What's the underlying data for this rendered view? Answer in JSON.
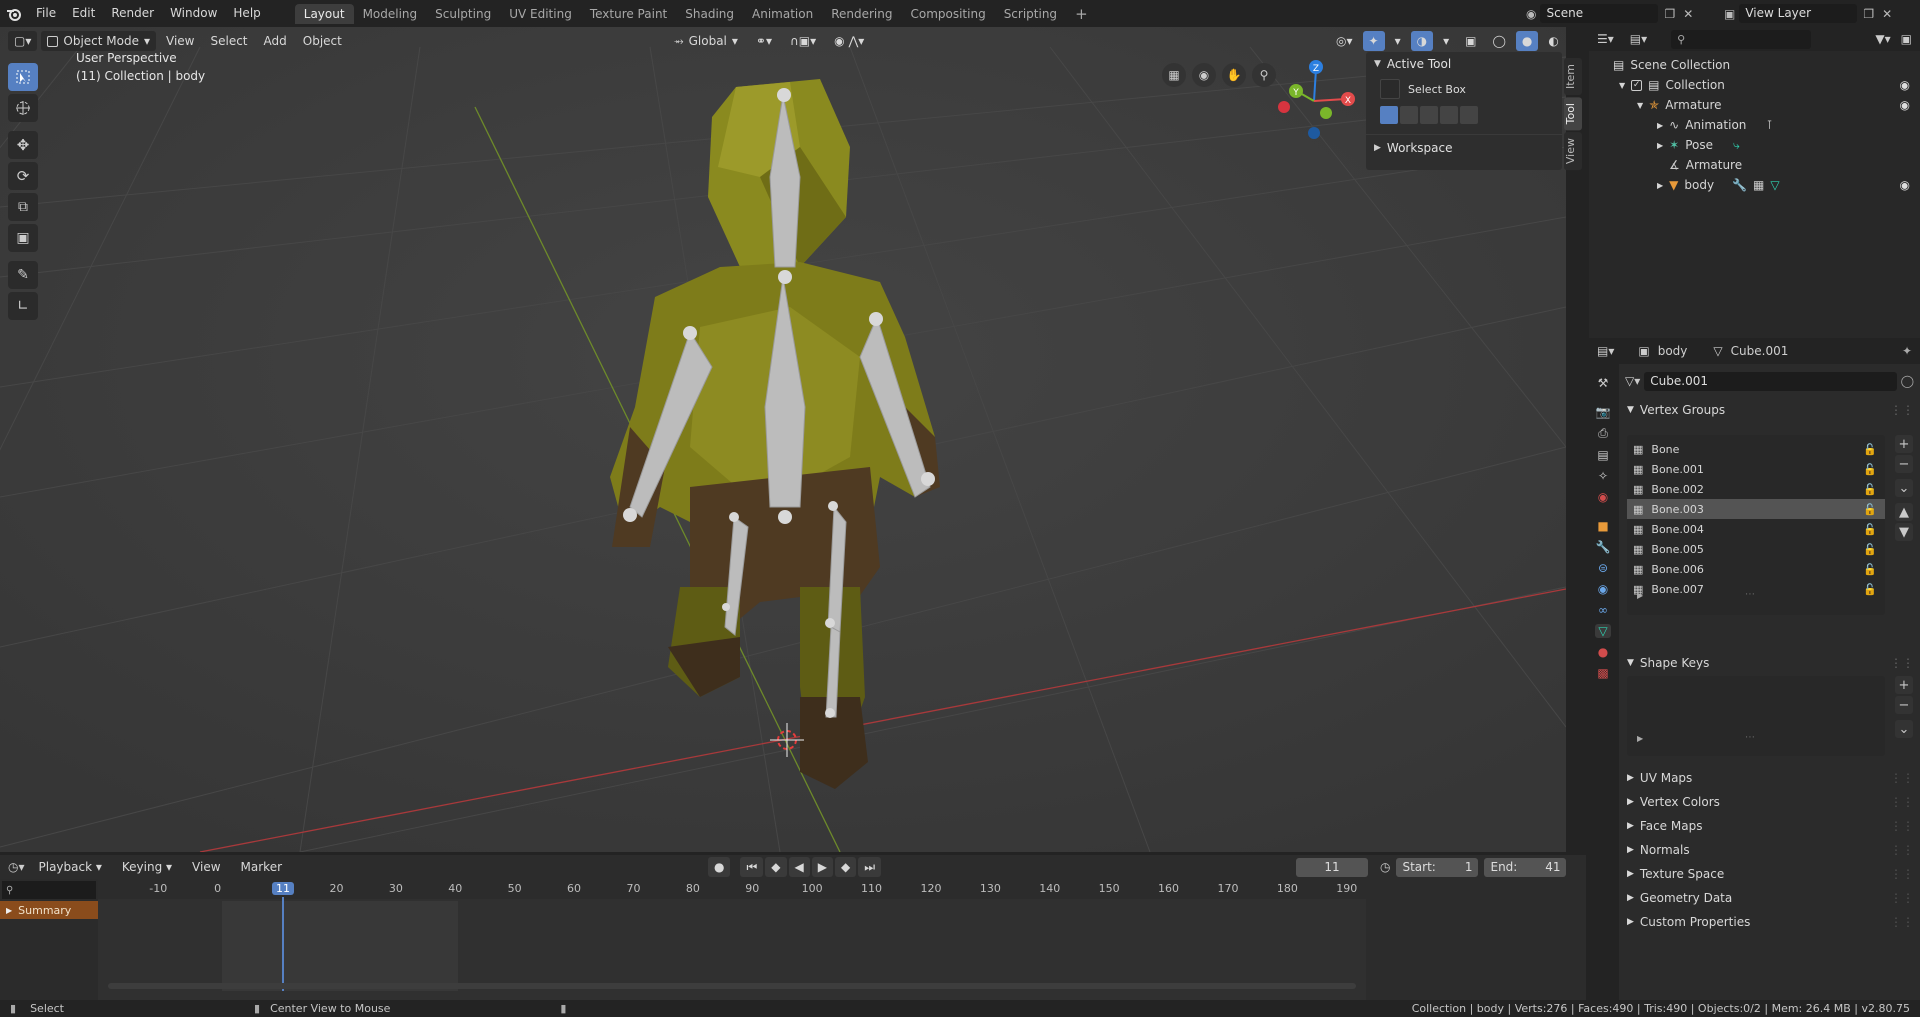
{
  "app": {
    "icon": "blender-icon"
  },
  "menus": [
    "File",
    "Edit",
    "Render",
    "Window",
    "Help"
  ],
  "workspaces": [
    "Layout",
    "Modeling",
    "Sculpting",
    "UV Editing",
    "Texture Paint",
    "Shading",
    "Animation",
    "Rendering",
    "Compositing",
    "Scripting"
  ],
  "active_workspace": "Layout",
  "scene": {
    "name": "Scene",
    "view_layer": "View Layer"
  },
  "viewport": {
    "mode": "Object Mode",
    "menus": [
      "View",
      "Select",
      "Add",
      "Object"
    ],
    "transform_orientation": "Global",
    "overlay_title": "User Perspective",
    "overlay_subtitle": "(11) Collection | body",
    "gizmo": {
      "x": "X",
      "y": "Y",
      "z": "Z"
    },
    "tools": [
      "select-box-icon",
      "cursor-icon",
      "move-icon",
      "rotate-icon",
      "scale-icon",
      "transform-icon",
      "annotate-icon",
      "measure-icon"
    ]
  },
  "npanel": {
    "active_tool_header": "Active Tool",
    "tool_name": "Select Box",
    "workspace_header": "Workspace",
    "tabs": [
      "Item",
      "Tool",
      "View"
    ]
  },
  "outliner": {
    "search_placeholder": "",
    "rows": [
      {
        "label": "Scene Collection"
      },
      {
        "label": "Collection"
      },
      {
        "label": "Armature"
      },
      {
        "label": "Animation"
      },
      {
        "label": "Pose"
      },
      {
        "label": "Armature"
      },
      {
        "label": "body"
      }
    ]
  },
  "properties": {
    "object_name": "body",
    "data_name": "Cube.001",
    "mesh_field": "Cube.001",
    "vertex_groups_header": "Vertex Groups",
    "vertex_groups": [
      "Bone",
      "Bone.001",
      "Bone.002",
      "Bone.003",
      "Bone.004",
      "Bone.005",
      "Bone.006",
      "Bone.007"
    ],
    "selected_group": "Bone.003",
    "shape_keys_header": "Shape Keys",
    "collapsed_sections": [
      "UV Maps",
      "Vertex Colors",
      "Face Maps",
      "Normals",
      "Texture Space",
      "Geometry Data",
      "Custom Properties"
    ]
  },
  "timeline": {
    "menus": [
      "Playback",
      "Keying",
      "View",
      "Marker"
    ],
    "current_frame": "11",
    "start_label": "Start:",
    "start": "1",
    "end_label": "End:",
    "end": "41",
    "ruler": [
      "-10",
      "0",
      "11",
      "20",
      "30",
      "40",
      "50",
      "60",
      "70",
      "80",
      "90",
      "100",
      "110",
      "120",
      "130",
      "140",
      "150",
      "160",
      "170",
      "180",
      "190"
    ],
    "summary": "Summary"
  },
  "status": {
    "left_action": "Select",
    "middle_action": "Center View to Mouse",
    "stats": "Collection | body | Verts:276 | Faces:490 | Tris:490 | Objects:0/2 | Mem: 26.4 MB | v2.80.75"
  },
  "colors": {
    "accent": "#5680c2",
    "x_axis": "#e34b4b",
    "y_axis": "#7ab62a",
    "z_axis": "#2c7fe0",
    "selection": "#545454"
  }
}
